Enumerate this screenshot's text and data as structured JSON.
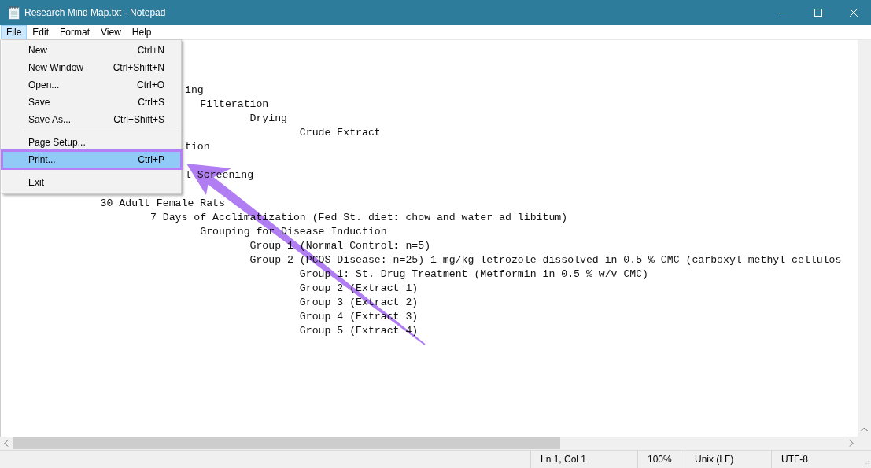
{
  "window": {
    "title": "Research Mind Map.txt - Notepad"
  },
  "menu_bar": [
    {
      "label": "File",
      "selected": true
    },
    {
      "label": "Edit",
      "selected": false
    },
    {
      "label": "Format",
      "selected": false
    },
    {
      "label": "View",
      "selected": false
    },
    {
      "label": "Help",
      "selected": false
    }
  ],
  "file_menu": [
    {
      "kind": "item",
      "label": "New",
      "shortcut": "Ctrl+N",
      "selected": false
    },
    {
      "kind": "item",
      "label": "New Window",
      "shortcut": "Ctrl+Shift+N",
      "selected": false
    },
    {
      "kind": "item",
      "label": "Open...",
      "shortcut": "Ctrl+O",
      "selected": false
    },
    {
      "kind": "item",
      "label": "Save",
      "shortcut": "Ctrl+S",
      "selected": false
    },
    {
      "kind": "item",
      "label": "Save As...",
      "shortcut": "Ctrl+Shift+S",
      "selected": false
    },
    {
      "kind": "separator"
    },
    {
      "kind": "item",
      "label": "Page Setup...",
      "selected": false
    },
    {
      "kind": "item",
      "label": "Print...",
      "shortcut": "Ctrl+P",
      "selected": true
    },
    {
      "kind": "separator"
    },
    {
      "kind": "item",
      "label": "Exit",
      "selected": false
    }
  ],
  "editor": {
    "lines": [
      {
        "kind": "hidden"
      },
      {
        "kind": "hidden"
      },
      {
        "kind": "hidden",
        "children": [
          {
            "kind": "clipped",
            "text": "ing",
            "children": [
              {
                "kind": "text",
                "text": "Filteration",
                "children": [
                  {
                    "kind": "text",
                    "text": "Drying",
                    "children": [
                      {
                        "kind": "text",
                        "text": "Crude Extract"
                      }
                    ]
                  }
                ]
              }
            ]
          },
          {
            "kind": "clipped",
            "text": "tion"
          },
          {
            "kind": "hidden"
          },
          {
            "kind": "clipped",
            "text": "l Screening"
          },
          {
            "kind": "hidden"
          }
        ]
      },
      {
        "kind": "text",
        "text": "30 Adult Female Rats",
        "children": [
          {
            "kind": "text",
            "text": "7 Days of Acclimatization (Fed St. diet: chow and water ad libitum)",
            "children": [
              {
                "kind": "text",
                "text": "Grouping for Disease Induction",
                "children": [
                  {
                    "kind": "text",
                    "text": "Group 1 (Normal Control: n=5)"
                  },
                  {
                    "kind": "text",
                    "text": "Group 2 (PCOS Disease: n=25) 1 mg/kg letrozole dissolved in 0.5 % CMC (carboxyl methyl cellulos",
                    "children": [
                      {
                        "kind": "text",
                        "text": "Group 1: St. Drug Treatment (Metformin in 0.5 % w/v CMC)"
                      },
                      {
                        "kind": "text",
                        "text": "Group 2 (Extract 1)"
                      },
                      {
                        "kind": "text",
                        "text": "Group 3 (Extract 2)"
                      },
                      {
                        "kind": "text",
                        "text": "Group 4 (Extract 3)"
                      },
                      {
                        "kind": "text",
                        "text": "Group 5 (Extract 4)"
                      }
                    ]
                  }
                ]
              }
            ]
          }
        ]
      }
    ]
  },
  "status_bar": {
    "position": "Ln 1, Col 1",
    "zoom": "100%",
    "line_endings": "Unix (LF)",
    "encoding": "UTF-8"
  },
  "annotations": {
    "highlight_frame": true,
    "pointer_arrow": true
  }
}
